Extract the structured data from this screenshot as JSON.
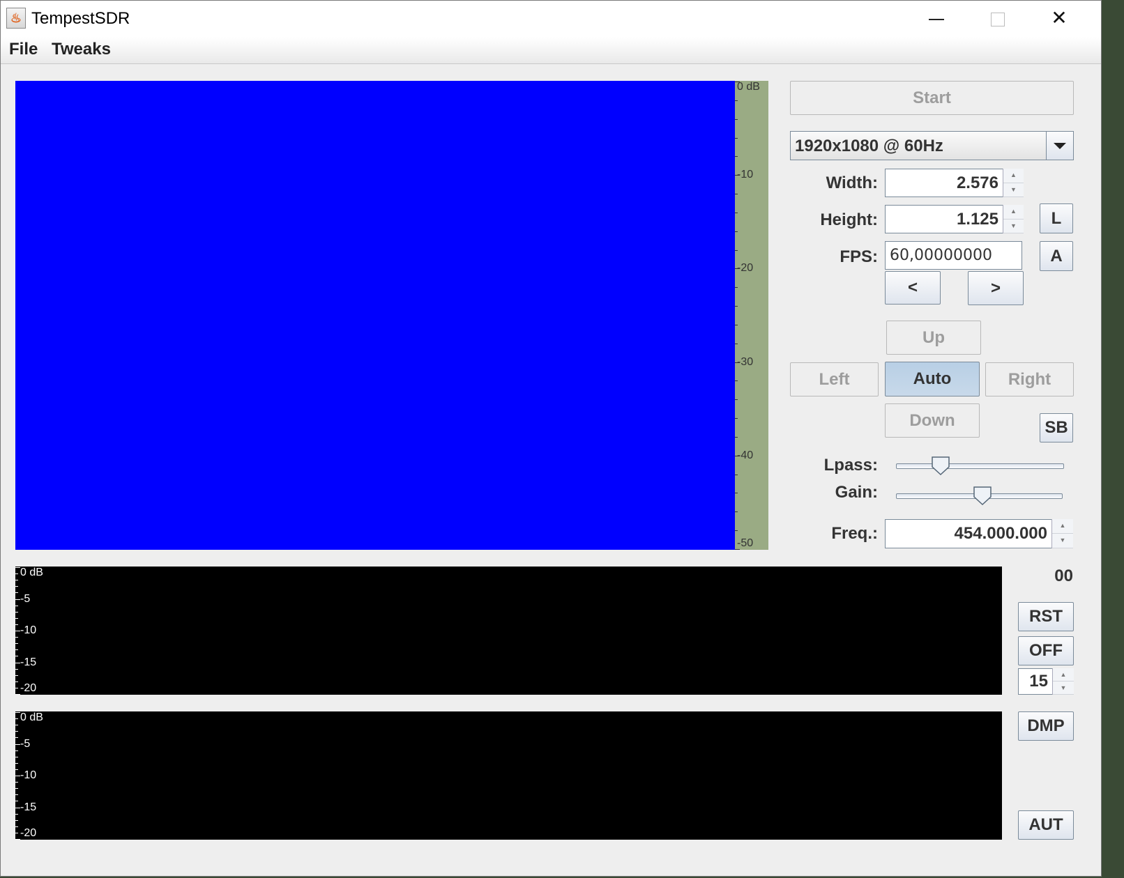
{
  "window": {
    "title": "TempestSDR",
    "icon": "java-cup-icon"
  },
  "menu": {
    "file": "File",
    "tweaks": "Tweaks"
  },
  "waterfall": {
    "color": "#0000ff",
    "scale_labels": [
      "0 dB",
      "-10",
      "-20",
      "-30",
      "-40",
      "-50"
    ]
  },
  "controls": {
    "start_label": "Start",
    "resolution": "1920x1080 @ 60Hz",
    "width_label": "Width:",
    "width_value": "2.576",
    "height_label": "Height:",
    "height_value": "1.125",
    "fps_label": "FPS:",
    "fps_value": "60,00000000",
    "prev_label": "<",
    "next_label": ">",
    "l_label": "L",
    "a_label": "A",
    "up_label": "Up",
    "left_label": "Left",
    "auto_label": "Auto",
    "right_label": "Right",
    "down_label": "Down",
    "sb_label": "SB",
    "lpass_label": "Lpass:",
    "gain_label": "Gain:",
    "lpass_level": 0.23,
    "gain_level": 0.52,
    "freq_label": "Freq.:",
    "freq_value": "454.000.000"
  },
  "spectrum": {
    "scale_labels": [
      "0 dB",
      "-5",
      "-10",
      "-15",
      "-20"
    ]
  },
  "side": {
    "counter": "00",
    "rst_label": "RST",
    "off_label": "OFF",
    "frames_value": "15",
    "dmp_label": "DMP",
    "aut_label": "AUT"
  }
}
